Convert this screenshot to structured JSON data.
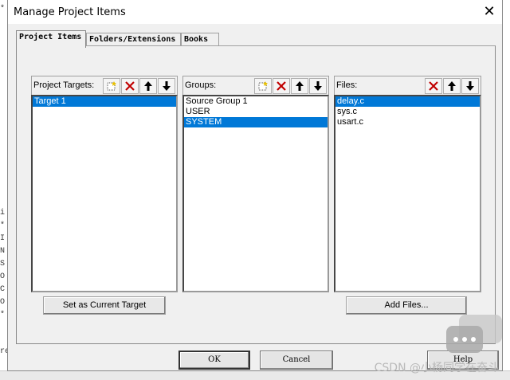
{
  "window": {
    "title": "Manage Project Items",
    "close_glyph": "✕"
  },
  "tabs": [
    {
      "label": "Project Items",
      "active": true
    },
    {
      "label": "Folders/Extensions",
      "active": false
    },
    {
      "label": "Books",
      "active": false
    }
  ],
  "targets": {
    "label": "Project Targets:",
    "items": [
      {
        "text": "Target 1",
        "selected": true
      }
    ]
  },
  "groups": {
    "label": "Groups:",
    "items": [
      {
        "text": "Source Group 1",
        "selected": false
      },
      {
        "text": "USER",
        "selected": false
      },
      {
        "text": "SYSTEM",
        "selected": true
      }
    ]
  },
  "files": {
    "label": "Files:",
    "items": [
      {
        "text": "delay.c",
        "selected": true
      },
      {
        "text": "sys.c",
        "selected": false
      },
      {
        "text": "usart.c",
        "selected": false
      }
    ]
  },
  "buttons": {
    "set_target": "Set as Current Target",
    "add_files": "Add Files...",
    "ok": "OK",
    "cancel": "Cancel",
    "help": "Help"
  },
  "background": {
    "left_chars": [
      "*",
      "i",
      "*",
      "I",
      "N",
      "S",
      "O",
      "C",
      "O",
      "*",
      "re"
    ]
  },
  "watermark": {
    "text": "CSDN @小杨同学在奋斗"
  },
  "icons": {
    "new": "new-item-icon",
    "delete": "delete-icon",
    "up": "move-up-icon",
    "down": "move-down-icon"
  },
  "colors": {
    "selection": "#0078d7",
    "delete_red": "#c00000"
  }
}
